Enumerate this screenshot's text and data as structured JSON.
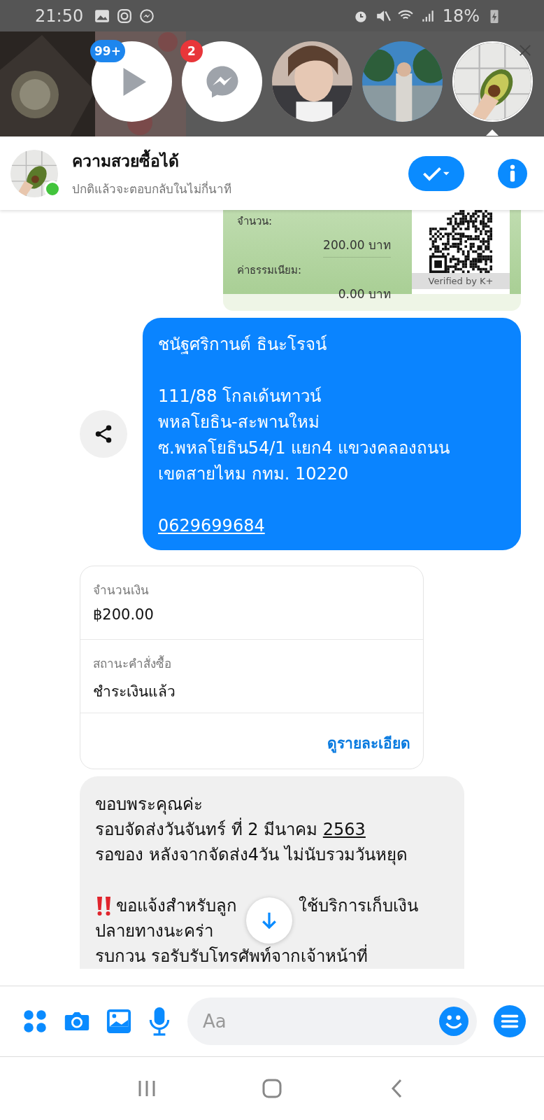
{
  "status_bar": {
    "time": "21:50",
    "battery": "18%"
  },
  "chat_heads": [
    {
      "kind": "video",
      "badge": "99+",
      "selected": false
    },
    {
      "kind": "messenger",
      "badge": "2",
      "selected": false
    },
    {
      "kind": "picture",
      "selected": false
    },
    {
      "kind": "picture",
      "selected": false
    },
    {
      "kind": "picture",
      "selected": true
    }
  ],
  "header": {
    "name": "ความสวยซื้อได้",
    "subtitle": "ปกติแล้วจะตอบกลับในไม่กี่นาที",
    "online": true
  },
  "receipt": {
    "amount_label": "จำนวน:",
    "amount": "200.00 บาท",
    "fee_label": "ค่าธรรมเนียม:",
    "fee": "0.00 บาท",
    "verified": "Verified by K+"
  },
  "address_message": {
    "lines": [
      {
        "kind": "text",
        "text": "ชนัฐศริกานต์ ธินะโรจน์"
      },
      {
        "kind": "blank"
      },
      {
        "kind": "text",
        "text": "111/88 โกลเด้นทาวน์"
      },
      {
        "kind": "text",
        "text": "พหลโยธิน-สะพานใหม่"
      },
      {
        "kind": "text",
        "text": "ซ.พหลโยธิน54/1 แยก4 แขวงคลองถนน"
      },
      {
        "kind": "text",
        "text": "เขตสายไหม กทม. 10220"
      },
      {
        "kind": "blank"
      }
    ],
    "phone": "0629699684"
  },
  "order_card": {
    "fields": [
      {
        "label": "จำนวนเงิน",
        "value": "฿200.00"
      },
      {
        "label": "สถานะคำสั่งซื้อ",
        "value": "ชำระเงินแล้ว"
      }
    ],
    "link": "ดูรายละเอียด"
  },
  "reply_message": {
    "lines": [
      {
        "kind": "text",
        "text": "ขอบพระคุณค่ะ"
      },
      {
        "kind": "text",
        "text": "รอบจัดส่งวันจันทร์ ที่ 2 มีนาคม ",
        "link": "2563"
      },
      {
        "kind": "text",
        "text": "รอของ หลังจากจัดส่ง4วัน ไม่นับรวมวันหยุด"
      },
      {
        "kind": "blank"
      },
      {
        "kind": "warning",
        "text": "ขอแจ้งสำหรับลูก",
        "text_after": "ใช้บริการเก็บเงิน"
      },
      {
        "kind": "text",
        "text": "ปลายทางนะคร่า"
      },
      {
        "kind": "text",
        "text": " รบกวน รอรับรับโทรศัพท์จากเจ้าหน้าที่"
      }
    ]
  },
  "composer": {
    "placeholder": "Aa"
  }
}
